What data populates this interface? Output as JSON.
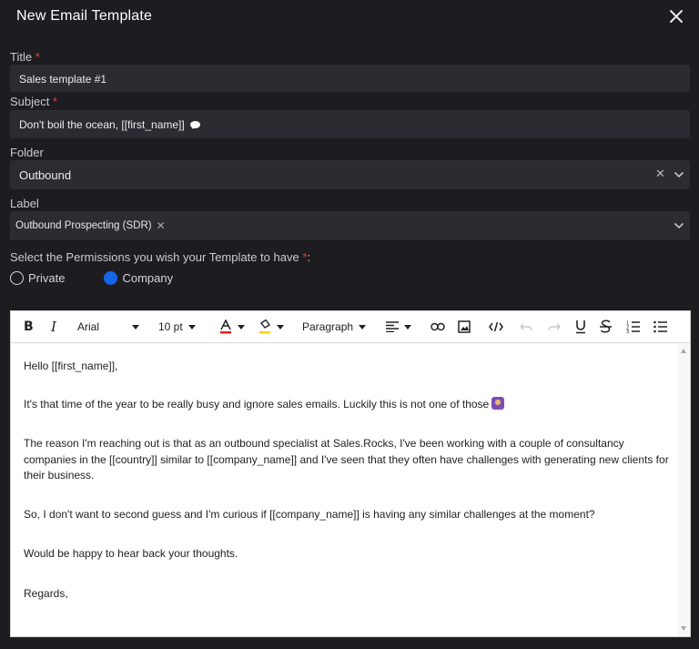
{
  "dialog": {
    "title": "New Email Template",
    "close_icon": "close-icon"
  },
  "fields": {
    "title_label": "Title",
    "title_value": "Sales template #1",
    "subject_label": "Subject",
    "subject_value": "Don't boil the ocean, [[first_name]]",
    "folder_label": "Folder",
    "folder_value": "Outbound",
    "label_label": "Label",
    "label_chip": "Outbound Prospecting (SDR)",
    "required_mark": "*"
  },
  "permissions": {
    "prompt": "Select the Permissions you wish your Template to have",
    "required_mark": "*",
    "colon": ":",
    "options": [
      {
        "label": "Private",
        "selected": false
      },
      {
        "label": "Company",
        "selected": true
      }
    ]
  },
  "toolbar": {
    "font_family": "Arial",
    "font_size": "10 pt",
    "block_format": "Paragraph",
    "icons": [
      "bold-icon",
      "italic-icon",
      "text-color-icon",
      "highlight-icon",
      "align-icon",
      "link-icon",
      "image-icon",
      "code-icon",
      "undo-icon",
      "redo-icon",
      "underline-icon",
      "strikethrough-icon",
      "numbered-list-icon",
      "bullet-list-icon"
    ]
  },
  "body": {
    "p1": "Hello [[first_name]],",
    "p2": "It's that time of the year to be really busy and ignore sales emails. Luckily this is not one of those",
    "p3": "The reason I'm reaching out is that as an outbound specialist at Sales.Rocks, I've been working with a couple of consultancy companies in the [[country]] similar to [[company_name]] and I've seen that they often have challenges with generating new clients for their business.",
    "p4": "So, I don't want to second guess and I'm curious if [[company_name]] is having any similar challenges at the moment?",
    "p5": "Would be happy to hear back your thoughts.",
    "p6": "Regards,"
  },
  "colors": {
    "background": "#1d1d21",
    "field": "#2b2b31",
    "accent": "#1565e8",
    "required": "#e0413c"
  }
}
